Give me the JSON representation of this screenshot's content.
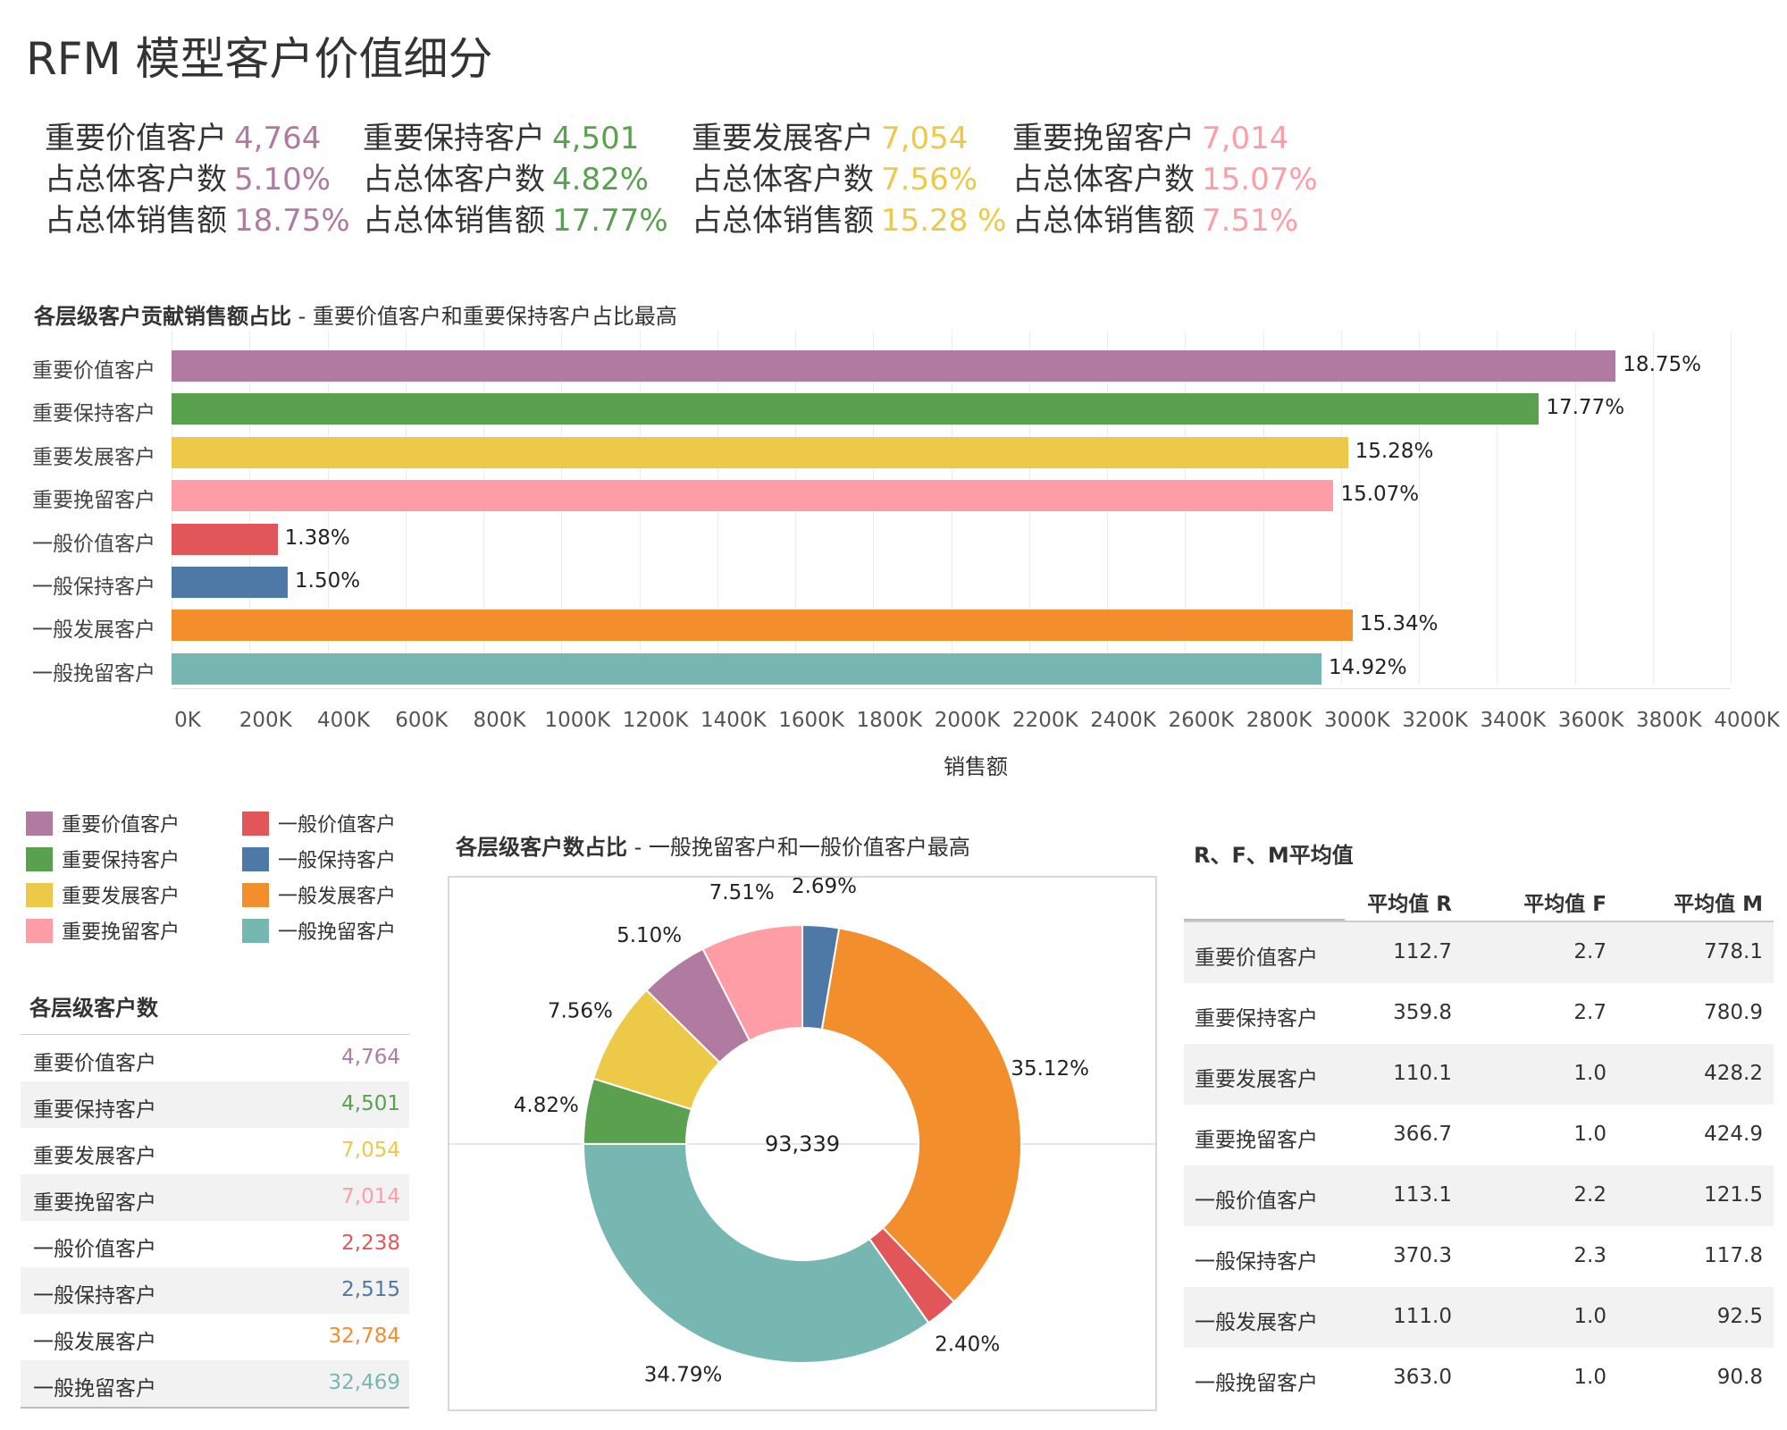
{
  "page": {
    "title": "RFM 模型客户价值细分"
  },
  "kpis": [
    {
      "segment": "重要价值客户",
      "count": "4,764",
      "share_label": "占总体客户数",
      "share": "5.10%",
      "sales_label": "占总体销售额",
      "sales": "18.75%",
      "color": "#b07aa1"
    },
    {
      "segment": "重要保持客户",
      "count": "4,501",
      "share_label": "占总体客户数",
      "share": "4.82%",
      "sales_label": "占总体销售额",
      "sales": "17.77%",
      "color": "#59a14f"
    },
    {
      "segment": "重要发展客户",
      "count": "7,054",
      "share_label": "占总体客户数",
      "share": "7.56%",
      "sales_label": "占总体销售额",
      "sales": "15.28 %",
      "color": "#edc948"
    },
    {
      "segment": "重要挽留客户",
      "count": "7,014",
      "share_label": "占总体客户数",
      "share": "15.07%",
      "sales_label": "占总体销售额",
      "sales": "7.51%",
      "color": "#ff9da7"
    }
  ],
  "bar_section": {
    "title_bold": "各层级客户贡献销售额占比",
    "title_rest": " - 重要价值客户和重要保持客户占比最高"
  },
  "legend": [
    {
      "label": "重要价值客户",
      "color": "#b07aa1"
    },
    {
      "label": "一般价值客户",
      "color": "#e15759"
    },
    {
      "label": "重要保持客户",
      "color": "#59a14f"
    },
    {
      "label": "一般保持客户",
      "color": "#4e79a7"
    },
    {
      "label": "重要发展客户",
      "color": "#edc948"
    },
    {
      "label": "一般发展客户",
      "color": "#f28e2b"
    },
    {
      "label": "重要挽留客户",
      "color": "#ff9da7"
    },
    {
      "label": "一般挽留客户",
      "color": "#76b7b2"
    }
  ],
  "count_section": {
    "title": "各层级客户数",
    "rows": [
      {
        "label": "重要价值客户",
        "value": "4,764",
        "color": "#b07aa1"
      },
      {
        "label": "重要保持客户",
        "value": "4,501",
        "color": "#59a14f"
      },
      {
        "label": "重要发展客户",
        "value": "7,054",
        "color": "#edc948"
      },
      {
        "label": "重要挽留客户",
        "value": "7,014",
        "color": "#ff9da7"
      },
      {
        "label": "一般价值客户",
        "value": "2,238",
        "color": "#e15759"
      },
      {
        "label": "一般保持客户",
        "value": "2,515",
        "color": "#4e79a7"
      },
      {
        "label": "一般发展客户",
        "value": "32,784",
        "color": "#f28e2b"
      },
      {
        "label": "一般挽留客户",
        "value": "32,469",
        "color": "#76b7b2"
      }
    ]
  },
  "donut_section": {
    "title_bold": "各层级客户数占比",
    "title_rest": " - 一般挽留客户和一般价值客户最高"
  },
  "rfm_section": {
    "title": "R、F、M平均值",
    "headers": [
      "平均值 R",
      "平均值 F",
      "平均值 M"
    ],
    "rows": [
      {
        "label": "重要价值客户",
        "r": "112.7",
        "f": "2.7",
        "m": "778.1"
      },
      {
        "label": "重要保持客户",
        "r": "359.8",
        "f": "2.7",
        "m": "780.9"
      },
      {
        "label": "重要发展客户",
        "r": "110.1",
        "f": "1.0",
        "m": "428.2"
      },
      {
        "label": "重要挽留客户",
        "r": "366.7",
        "f": "1.0",
        "m": "424.9"
      },
      {
        "label": "一般价值客户",
        "r": "113.1",
        "f": "2.2",
        "m": "121.5"
      },
      {
        "label": "一般保持客户",
        "r": "370.3",
        "f": "2.3",
        "m": "117.8"
      },
      {
        "label": "一般发展客户",
        "r": "111.0",
        "f": "1.0",
        "m": "92.5"
      },
      {
        "label": "一般挽留客户",
        "r": "363.0",
        "f": "1.0",
        "m": "90.8"
      }
    ]
  },
  "chart_data": [
    {
      "type": "bar",
      "orientation": "horizontal",
      "title": "各层级客户贡献销售额占比 - 重要价值客户和重要保持客户占比最高",
      "xlabel": "销售额",
      "ylabel": "",
      "xlim": [
        0,
        4000000
      ],
      "x_ticks": [
        "0K",
        "200K",
        "400K",
        "600K",
        "800K",
        "1000K",
        "1200K",
        "1400K",
        "1600K",
        "1800K",
        "2000K",
        "2200K",
        "2400K",
        "2600K",
        "2800K",
        "3000K",
        "3200K",
        "3400K",
        "3600K",
        "3800K",
        "4000K"
      ],
      "grid": true,
      "categories": [
        "重要价值客户",
        "重要保持客户",
        "重要发展客户",
        "重要挽留客户",
        "一般价值客户",
        "一般保持客户",
        "一般发展客户",
        "一般挽留客户"
      ],
      "values": [
        3705000,
        3508000,
        3018000,
        2981000,
        272000,
        298000,
        3030000,
        2950000
      ],
      "data_labels": [
        "18.75%",
        "17.77%",
        "15.28%",
        "15.07%",
        "1.38%",
        "1.50%",
        "15.34%",
        "14.92%"
      ],
      "colors": [
        "#b07aa1",
        "#59a14f",
        "#edc948",
        "#ff9da7",
        "#e15759",
        "#4e79a7",
        "#f28e2b",
        "#76b7b2"
      ]
    },
    {
      "type": "pie",
      "variant": "donut",
      "title": "各层级客户数占比 - 一般挽留客户和一般价值客户最高",
      "center_label": "93,339",
      "slices": [
        {
          "label": "2.69%",
          "value": 2.69,
          "color": "#4e79a7"
        },
        {
          "label": "35.12%",
          "value": 35.12,
          "color": "#f28e2b"
        },
        {
          "label": "2.40%",
          "value": 2.4,
          "color": "#e15759"
        },
        {
          "label": "34.79%",
          "value": 34.79,
          "color": "#76b7b2"
        },
        {
          "label": "4.82%",
          "value": 4.82,
          "color": "#59a14f"
        },
        {
          "label": "7.56%",
          "value": 7.56,
          "color": "#edc948"
        },
        {
          "label": "5.10%",
          "value": 5.1,
          "color": "#b07aa1"
        },
        {
          "label": "7.51%",
          "value": 7.51,
          "color": "#ff9da7"
        }
      ]
    }
  ]
}
